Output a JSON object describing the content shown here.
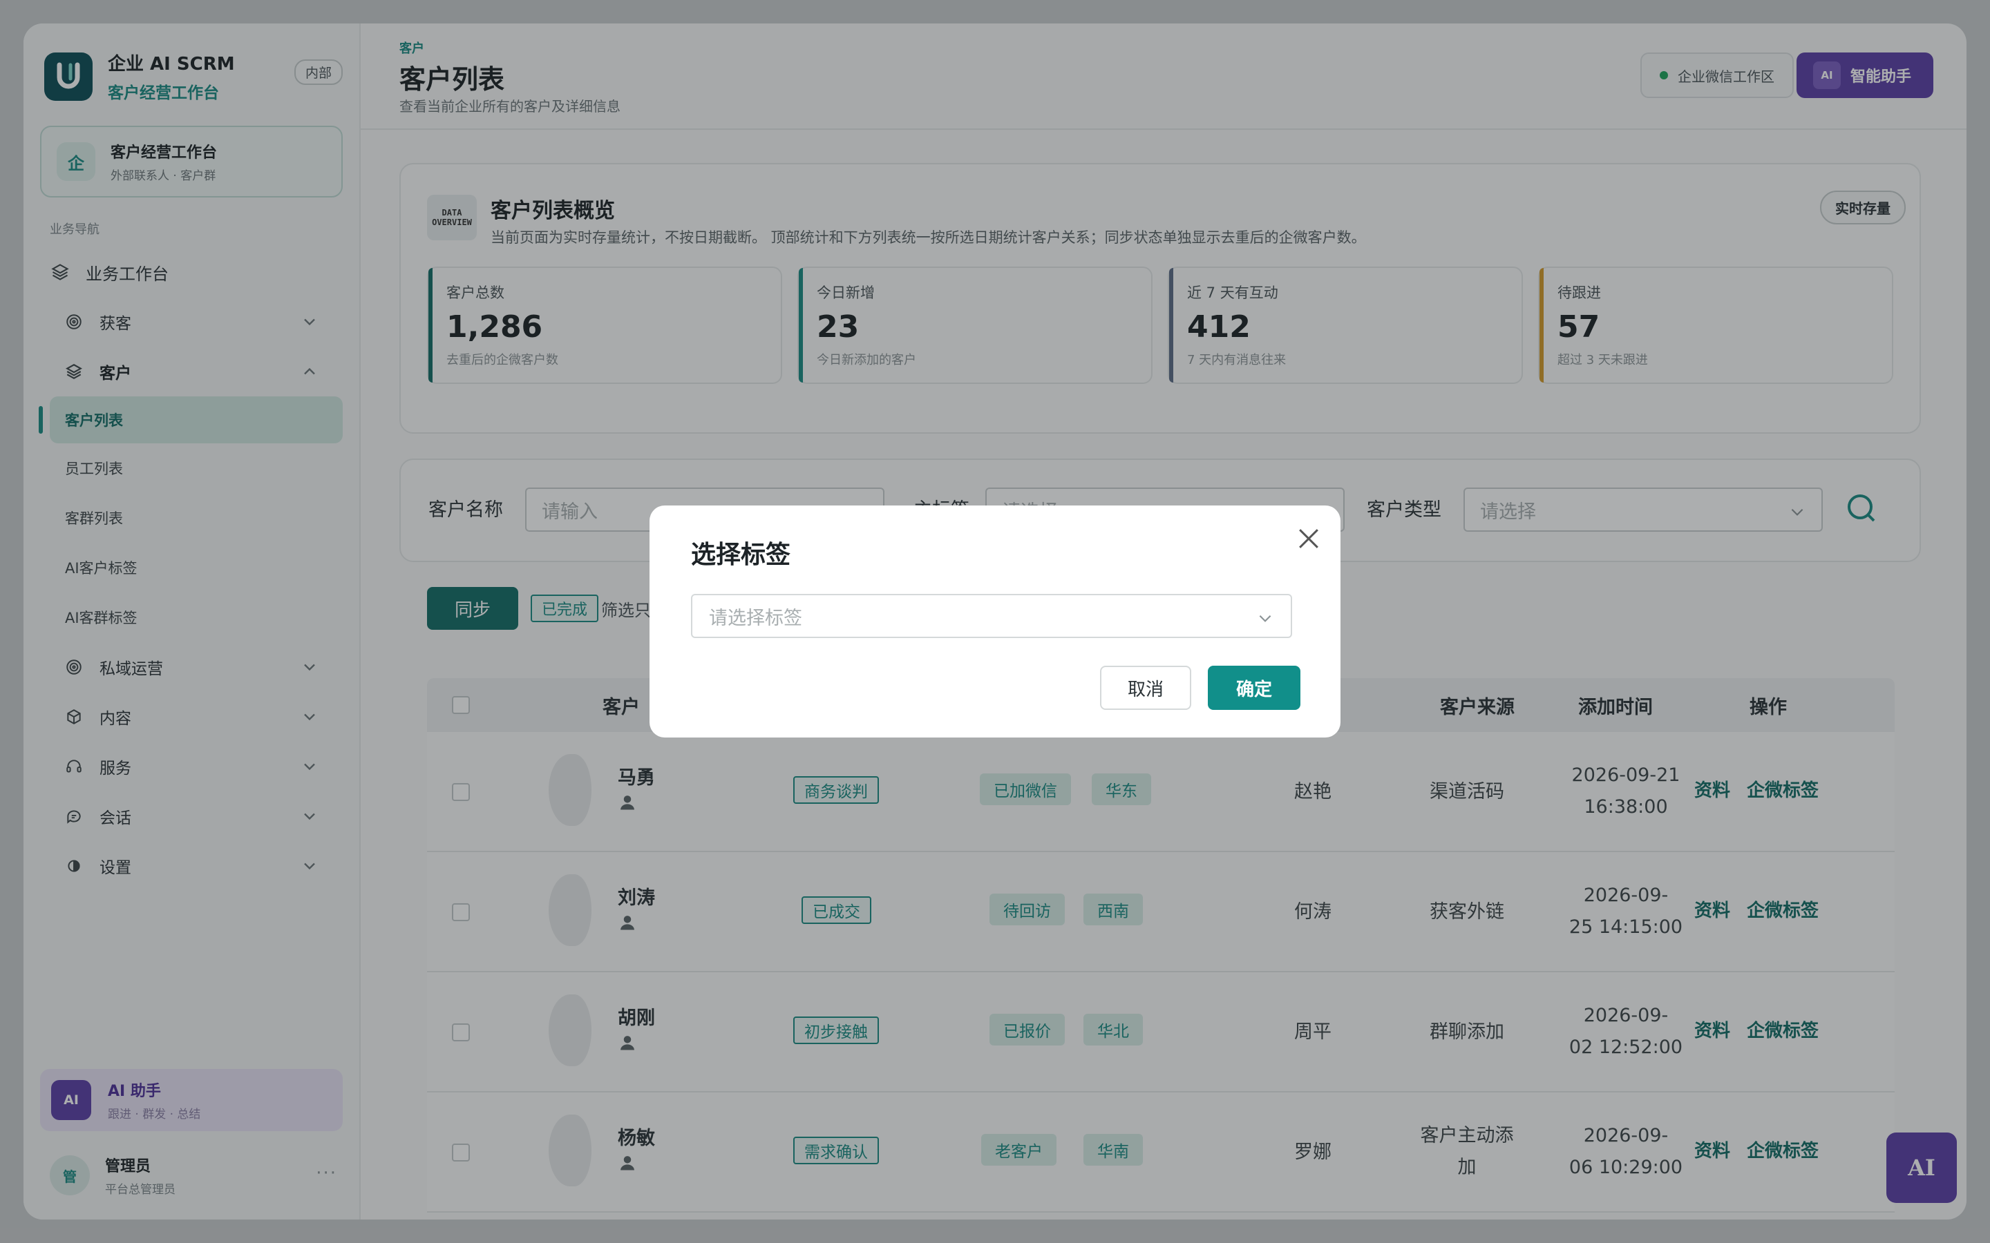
{
  "brand": {
    "title": "企业 AI SCRM",
    "subtitle": "客户经营工作台",
    "badge": "内部"
  },
  "workspace": {
    "icon_text": "企",
    "title": "客户经营工作台",
    "subtitle": "外部联系人 · 客户群"
  },
  "sidebar": {
    "section_label": "业务导航",
    "home": "业务工作台",
    "groups": [
      {
        "label": "获客",
        "icon": "target-icon"
      },
      {
        "label": "客户",
        "icon": "layers-icon"
      },
      {
        "label": "私域运营",
        "icon": "target-icon"
      },
      {
        "label": "内容",
        "icon": "box-icon"
      },
      {
        "label": "服务",
        "icon": "headset-icon"
      },
      {
        "label": "会话",
        "icon": "chat-icon"
      },
      {
        "label": "设置",
        "icon": "gear-icon"
      }
    ],
    "customer_items": [
      "客户列表",
      "员工列表",
      "客群列表",
      "AI客户标签",
      "AI客群标签"
    ]
  },
  "ai_card": {
    "icon_text": "AI",
    "title": "AI 助手",
    "subtitle": "跟进 · 群发 · 总结"
  },
  "user": {
    "avatar_text": "管",
    "name": "管理员",
    "role": "平台总管理员",
    "more": "···"
  },
  "header": {
    "breadcrumb": "客户",
    "title": "客户列表",
    "description": "查看当前企业所有的客户及详细信息",
    "workspace_chip": "企业微信工作区",
    "assistant_icon": "AI",
    "assistant_label": "智能助手"
  },
  "overview": {
    "icon_line1": "DATA",
    "icon_line2": "OVERVIEW",
    "title": "客户列表概览",
    "description": "当前页面为实时存量统计，不按日期截断。 顶部统计和下方列表统一按所选日期统计客户关系；同步状态单独显示去重后的企微客户数。",
    "badge": "实时存量",
    "stats": [
      {
        "label": "客户总数",
        "value": "1,286",
        "note": "去重后的企微客户数",
        "color": "#136c66"
      },
      {
        "label": "今日新增",
        "value": "23",
        "note": "今日新添加的客户",
        "color": "#1a8a83"
      },
      {
        "label": "近 7 天有互动",
        "value": "412",
        "note": "7 天内有消息往来",
        "color": "#5b6b85"
      },
      {
        "label": "待跟进",
        "value": "57",
        "note": "超过 3 天未跟进",
        "color": "#d49a2a"
      }
    ]
  },
  "filters": {
    "name_label": "客户名称",
    "name_placeholder": "请输入",
    "tag_label": "主标签",
    "tag_placeholder": "请选择",
    "type_label": "客户类型",
    "type_placeholder": "请选择"
  },
  "toolbar": {
    "sync_label": "同步",
    "done_tag": "已完成",
    "hint": "筛选只"
  },
  "table": {
    "headers": {
      "customer": "客户",
      "staff": "工",
      "source": "客户来源",
      "added": "添加时间",
      "actions": "操作"
    },
    "rows": [
      {
        "name": "马勇",
        "stage": "商务谈判",
        "tags": [
          "已加微信",
          "华东"
        ],
        "staff": "赵艳",
        "source": "渠道活码",
        "time1": "2026-09-21",
        "time2": "16:38:00"
      },
      {
        "name": "刘涛",
        "stage": "已成交",
        "tags": [
          "待回访",
          "西南"
        ],
        "staff": "何涛",
        "source": "获客外链",
        "time1": "2026-09-",
        "time2": "25 14:15:00"
      },
      {
        "name": "胡刚",
        "stage": "初步接触",
        "tags": [
          "已报价",
          "华北"
        ],
        "staff": "周平",
        "source": "群聊添加",
        "time1": "2026-09-",
        "time2": "02 12:52:00"
      },
      {
        "name": "杨敏",
        "stage": "需求确认",
        "tags": [
          "老客户",
          "华南"
        ],
        "staff": "罗娜",
        "source": "客户主动添加",
        "time1": "2026-09-",
        "time2": "06 10:29:00"
      }
    ],
    "action_detail": "资料",
    "action_tag": "企微标签"
  },
  "float_ai": "AI",
  "modal": {
    "title": "选择标签",
    "select_placeholder": "请选择标签",
    "cancel": "取消",
    "confirm": "确定"
  }
}
